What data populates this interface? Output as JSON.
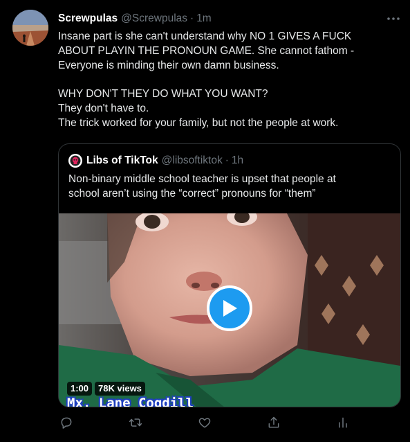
{
  "tweet": {
    "author_name": "Screwpulas",
    "author_handle": "@Screwpulas",
    "separator": "·",
    "time": "1m",
    "text_lines": [
      "Insane part is she can't understand why NO 1 GIVES A FUCK",
      "ABOUT PLAYIN THE PRONOUN GAME. She cannot fathom  -",
      "Everyone is minding their own damn business.",
      "WHY DON'T THEY DO WHAT YOU WANT?",
      "They don't have to.",
      "The trick worked for your family, but not the people at work."
    ]
  },
  "quoted": {
    "author_name": "Libs of TikTok",
    "author_handle": "@libsoftiktok",
    "separator": "·",
    "time": "1h",
    "text_lines": [
      "Non-binary middle school teacher is upset that people at",
      "school aren’t using the “correct” pronouns for “them”"
    ],
    "video": {
      "duration": "1:00",
      "views": "78K views",
      "caption": "Mx. Lane Cogdill"
    }
  },
  "icons": {
    "more": "more-icon",
    "reply": "reply-icon",
    "retweet": "retweet-icon",
    "like": "like-icon",
    "share": "share-icon",
    "analytics": "analytics-icon",
    "play": "play-icon"
  },
  "colors": {
    "background": "#000000",
    "text": "#e7e9ea",
    "muted": "#6e767d",
    "border": "#2f3336",
    "accent": "#1d9bf0"
  }
}
